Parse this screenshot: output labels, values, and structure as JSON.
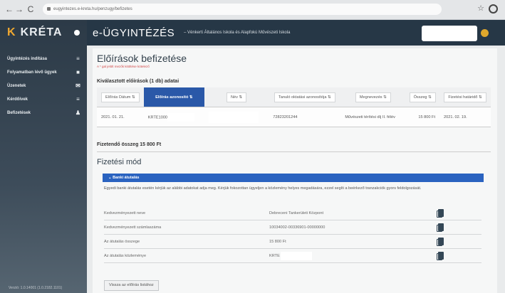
{
  "browser": {
    "url": "eugyintezes.e-kreta.hu/penzugy/befizetes",
    "back": "←",
    "forward": "→",
    "reload": "C",
    "extensions": "☆"
  },
  "sidebar": {
    "logo": "KRÉTA",
    "items": [
      {
        "label": "Ügyintézés indítása",
        "icon": "≡"
      },
      {
        "label": "Folyamatban lévő ügyek",
        "icon": "■"
      },
      {
        "label": "Üzenetek",
        "icon": "✉"
      },
      {
        "label": "Kérdőívek",
        "icon": "≡"
      },
      {
        "label": "Befizetések",
        "icon": "♟"
      }
    ],
    "version": "Verzió: 1.0.14001 (1.0.2182.1101)"
  },
  "header": {
    "app_title": "e-ÜGYINTÉZÉS",
    "school": "– Vénkerti Általános Iskola és Alapfokú Művészeti Iskola"
  },
  "main": {
    "title": "Előírások befizetése",
    "required_note": "A * gal jelölt mezők kitöltése kötelező",
    "selected_label": "Kiválasztott előírások (1 db) adatai",
    "columns": [
      "Előírás Dátum",
      "Előírás azonosító",
      "Név",
      "Tanuló oktatási azonosítója",
      "Megnevezés",
      "Összeg",
      "Fizetési határidő"
    ],
    "row": {
      "date": "2021. 01. 21.",
      "id_prefix": "KRTE1000",
      "student_id": "72823201244",
      "description": "Művészeti térítési díj II. félév",
      "amount": "15 800 Ft",
      "deadline": "2021. 02. 19."
    },
    "total": "Fizetendő összeg 15 800 Ft",
    "payment_title": "Fizetési mód",
    "bank_section": "Banki átutalás",
    "bank_desc": "Egyedi banki átutalás esetén kérjük az alábbi adatokat adja meg. Kérjük fokozottan ügyeljen a közlemény helyes megadására, ezzel segíti a beérkező tranzakciók gyors feldolgozását.",
    "info": [
      {
        "label": "Kedvezményezett neve",
        "value": "Debreceni Tankerületi Központ"
      },
      {
        "label": "Kedvezményezett számlaszáma",
        "value": "10034002-00336901-00000000"
      },
      {
        "label": "Az átutalás összege",
        "value": "15 800 Ft"
      },
      {
        "label": "Az átutalás közleménye",
        "value": "KRTE"
      }
    ],
    "back_button": "Vissza az előírás listához"
  },
  "colors": {
    "accent": "#2a58a8",
    "sidebar": "#2c3a47",
    "header": "#263746",
    "logo": "#f0a830"
  }
}
